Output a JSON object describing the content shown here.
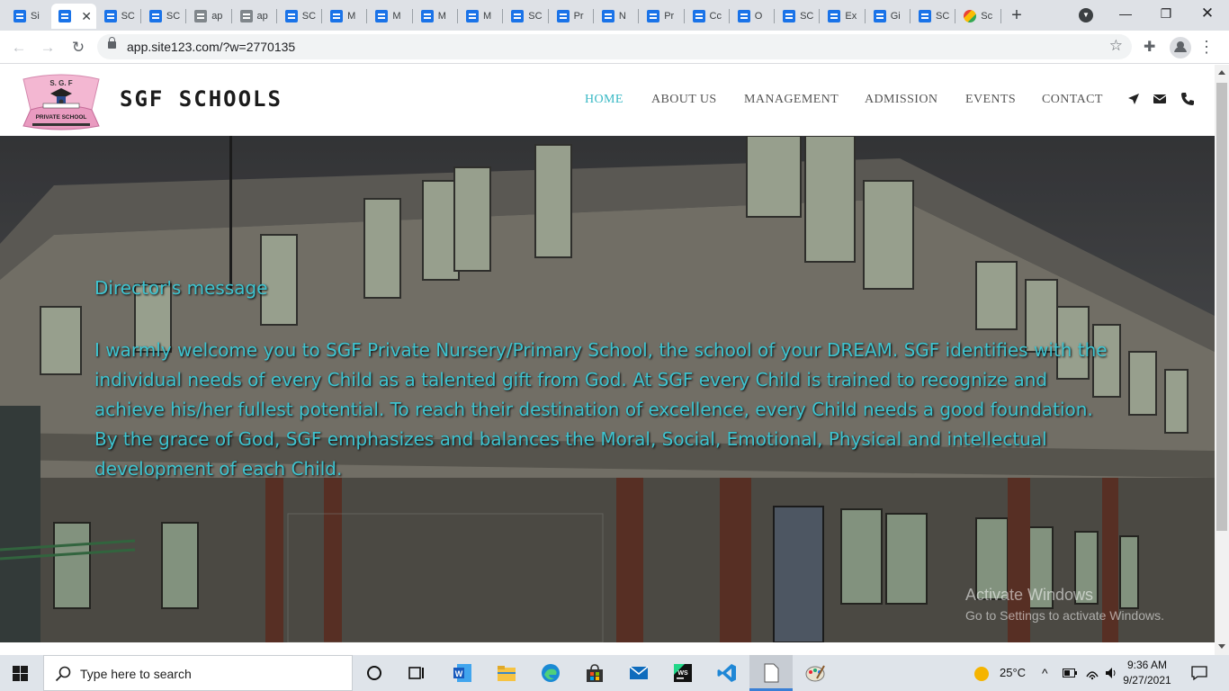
{
  "browser": {
    "tabs": [
      {
        "label": "Si",
        "icon": "site123-icon"
      },
      {
        "label": "",
        "icon": "site123-icon",
        "active": true
      },
      {
        "label": "SC",
        "icon": "site123-icon"
      },
      {
        "label": "SC",
        "icon": "site123-icon"
      },
      {
        "label": "ap",
        "icon": "page-icon"
      },
      {
        "label": "ap",
        "icon": "page-icon"
      },
      {
        "label": "SC",
        "icon": "site123-icon"
      },
      {
        "label": "M",
        "icon": "site123-icon"
      },
      {
        "label": "M",
        "icon": "site123-icon"
      },
      {
        "label": "M",
        "icon": "site123-icon"
      },
      {
        "label": "M",
        "icon": "site123-icon"
      },
      {
        "label": "SC",
        "icon": "site123-icon"
      },
      {
        "label": "Pr",
        "icon": "site123-icon"
      },
      {
        "label": "N",
        "icon": "site123-icon"
      },
      {
        "label": "Pr",
        "icon": "site123-icon"
      },
      {
        "label": "Cc",
        "icon": "site123-icon"
      },
      {
        "label": "O",
        "icon": "site123-icon"
      },
      {
        "label": "SC",
        "icon": "site123-icon"
      },
      {
        "label": "Ex",
        "icon": "site123-icon"
      },
      {
        "label": "Gi",
        "icon": "site123-icon"
      },
      {
        "label": "SC",
        "icon": "site123-icon"
      },
      {
        "label": "Sc",
        "icon": "colorful-icon"
      }
    ],
    "new_tab_label": "+",
    "url": "app.site123.com/?w=2770135"
  },
  "site": {
    "brand": "SGF SCHOOLS",
    "logo_top_text": "S. G. F",
    "logo_bottom_text": "PRIVATE SCHOOL",
    "nav": [
      {
        "label": "HOME",
        "active": true
      },
      {
        "label": "ABOUT US"
      },
      {
        "label": "MANAGEMENT"
      },
      {
        "label": "ADMISSION"
      },
      {
        "label": "EVENTS"
      },
      {
        "label": "CONTACT"
      }
    ],
    "accent_color": "#37b8c4",
    "hero": {
      "title": "Director's message",
      "body": "I warmly welcome you to SGF Private Nursery/Primary School, the school of your DREAM. SGF identifies with the individual needs of every Child as a talented gift from God. At SGF every Child is trained to recognize and achieve his/her fullest potential. To reach their destination of excellence, every Child needs a good foundation. By the grace of God, SGF emphasizes and balances the Moral, Social, Emotional, Physical and intellectual development of each Child."
    }
  },
  "watermark": {
    "line1": "Activate Windows",
    "line2": "Go to Settings to activate Windows."
  },
  "taskbar": {
    "search_placeholder": "Type here to search",
    "weather": "25°C",
    "time": "9:36 AM",
    "date": "9/27/2021"
  }
}
